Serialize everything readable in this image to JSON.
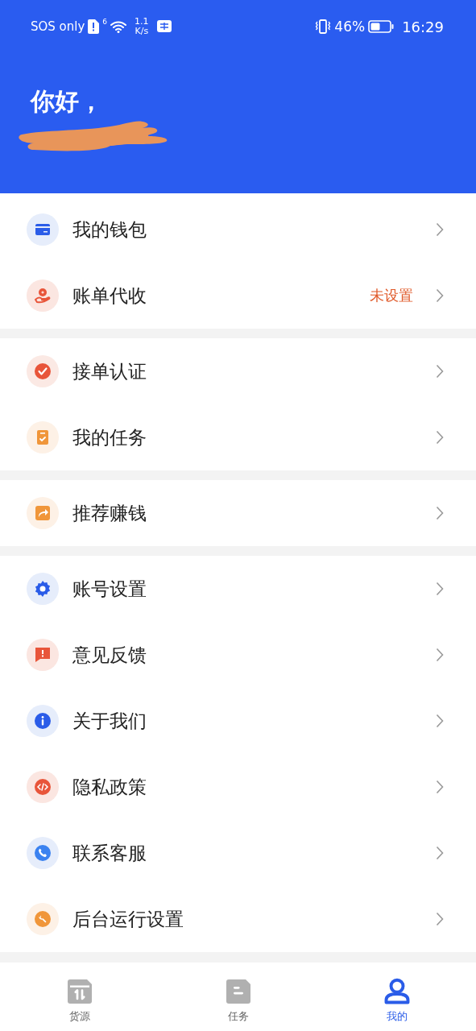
{
  "status_bar": {
    "carrier": "SOS only",
    "wifi_badge": "6",
    "speed_value": "1.1",
    "speed_unit": "K/s",
    "battery": "46%",
    "time": "16:29"
  },
  "header": {
    "greeting": "你好，"
  },
  "menu_groups": [
    {
      "items": [
        {
          "label": "我的钱包"
        },
        {
          "label": "账单代收",
          "status": "未设置"
        }
      ]
    },
    {
      "items": [
        {
          "label": "接单认证"
        },
        {
          "label": "我的任务"
        }
      ]
    },
    {
      "items": [
        {
          "label": "推荐赚钱"
        }
      ]
    },
    {
      "items": [
        {
          "label": "账号设置"
        },
        {
          "label": "意见反馈"
        },
        {
          "label": "关于我们"
        },
        {
          "label": "隐私政策"
        },
        {
          "label": "联系客服"
        },
        {
          "label": "后台运行设置"
        }
      ]
    }
  ],
  "tabs": [
    {
      "label": "货源",
      "selected": false
    },
    {
      "label": "任务",
      "selected": false
    },
    {
      "label": "我的",
      "selected": true
    }
  ]
}
